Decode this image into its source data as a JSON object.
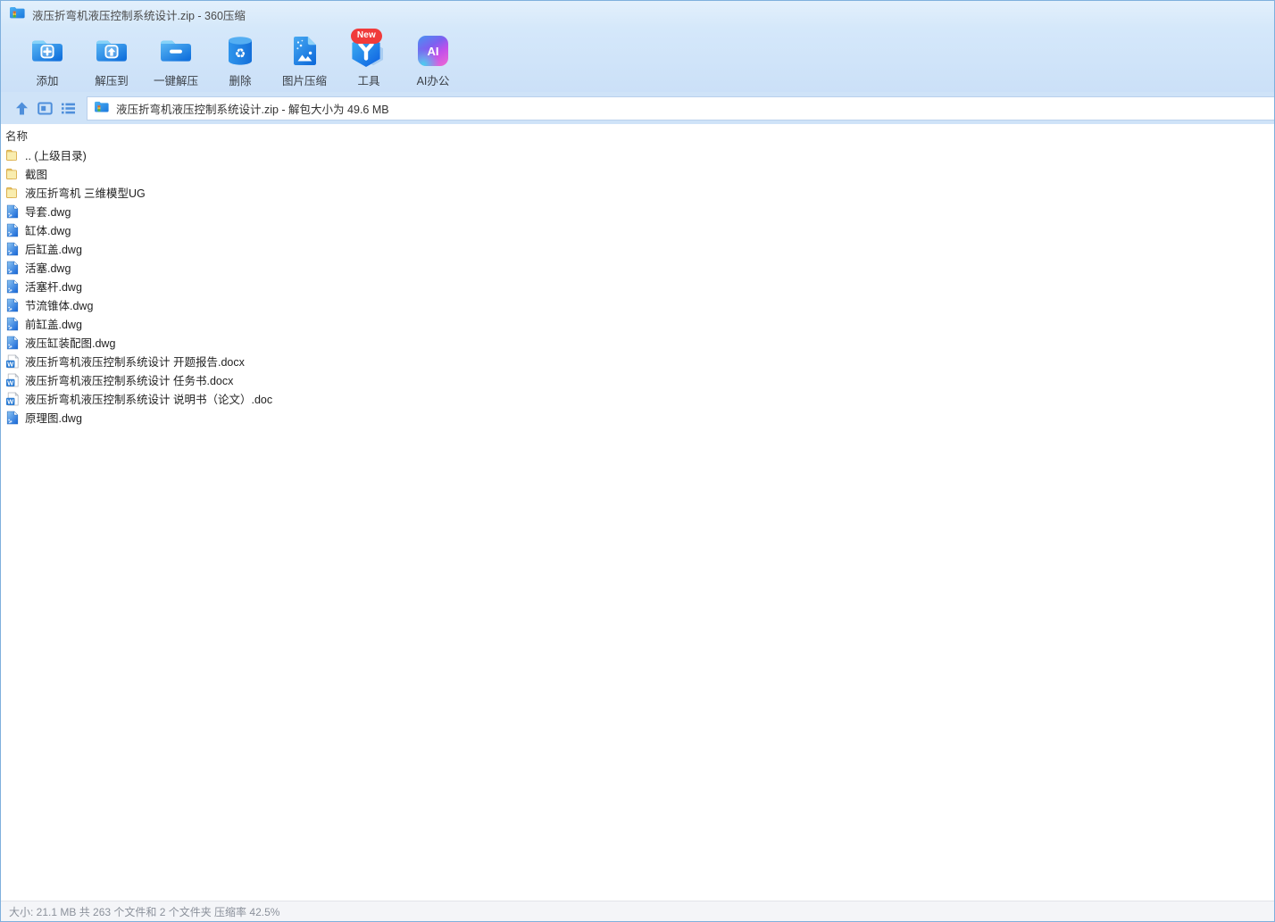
{
  "window": {
    "title": "液压折弯机液压控制系统设计.zip - 360压缩"
  },
  "toolbar": {
    "buttons": [
      {
        "id": "add",
        "label": "添加"
      },
      {
        "id": "extract-to",
        "label": "解压到"
      },
      {
        "id": "one-click-extract",
        "label": "一键解压"
      },
      {
        "id": "delete",
        "label": "删除"
      },
      {
        "id": "image-compress",
        "label": "图片压缩"
      },
      {
        "id": "tools",
        "label": "工具",
        "badge": "New"
      },
      {
        "id": "ai-office",
        "label": "AI办公",
        "icon_text": "AI"
      }
    ]
  },
  "navbar": {
    "address": "液压折弯机液压控制系统设计.zip - 解包大小为 49.6 MB"
  },
  "file_list": {
    "name_column": "名称",
    "rows": [
      {
        "name": ".. (上级目录)",
        "type": "folder"
      },
      {
        "name": "截图",
        "type": "folder"
      },
      {
        "name": "液压折弯机 三维模型UG",
        "type": "folder"
      },
      {
        "name": "导套.dwg",
        "type": "dwg"
      },
      {
        "name": "缸体.dwg",
        "type": "dwg"
      },
      {
        "name": "后缸盖.dwg",
        "type": "dwg"
      },
      {
        "name": "活塞.dwg",
        "type": "dwg"
      },
      {
        "name": "活塞杆.dwg",
        "type": "dwg"
      },
      {
        "name": "节流锥体.dwg",
        "type": "dwg"
      },
      {
        "name": "前缸盖.dwg",
        "type": "dwg"
      },
      {
        "name": "液压缸装配图.dwg",
        "type": "dwg"
      },
      {
        "name": "液压折弯机液压控制系统设计 开题报告.docx",
        "type": "word"
      },
      {
        "name": "液压折弯机液压控制系统设计 任务书.docx",
        "type": "word"
      },
      {
        "name": "液压折弯机液压控制系统设计 说明书（论文）.doc",
        "type": "word"
      },
      {
        "name": "原理图.dwg",
        "type": "dwg"
      }
    ]
  },
  "statusbar": {
    "text": "大小: 21.1 MB 共 263 个文件和 2 个文件夹 压缩率 42.5%"
  },
  "colors": {
    "accent_blue": "#1e7de0",
    "header_bg": "#d5e8fa",
    "nav_icon_blue": "#4f8fdb",
    "badge_red": "#f03b3b",
    "folder_fill": "#f8eaa6",
    "folder_border": "#d7a63c",
    "word_blue": "#2b7cd3",
    "status_text": "#8b919b"
  }
}
